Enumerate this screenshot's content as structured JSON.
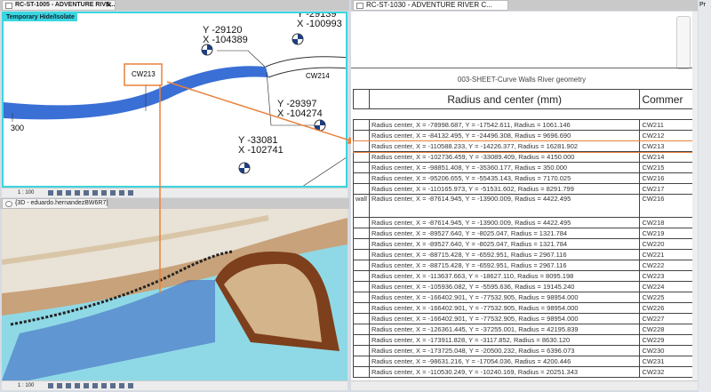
{
  "left_top": {
    "tab_title": "RC-ST-1005 - ADVENTURE RIVE...",
    "badge": "Temporary Hide/Isolate",
    "scale": "1 : 100",
    "tags": [
      {
        "y": "Y -29120",
        "x": "X -104389"
      },
      {
        "y": "Y -29139",
        "x": "X -100993"
      },
      {
        "y": "Y -29397",
        "x": "X -104274"
      },
      {
        "y": "Y -33081",
        "x": "X -102741"
      }
    ],
    "wall_labels": [
      "CW213",
      "CW214"
    ],
    "dim_label": "300"
  },
  "left_bottom": {
    "tab_title": "{3D - eduardo.hernandezBW6R7}",
    "scale": "1 : 100"
  },
  "right": {
    "tab_title": "RC-ST-1030 - ADVENTURE RIVER C...",
    "schedule_title": "003-SHEET-Curve Walls River geometry",
    "headers": [
      "",
      "Radius and center (mm)",
      "Commer"
    ],
    "rows": [
      [
        "",
        "Radius center, X = -78998.687, Y = -17542.611, Radius = 1061.146",
        "CW211"
      ],
      [
        "",
        "Radius center, X = -84132.495, Y = -24496.308, Radius = 9696.690",
        "CW212"
      ],
      [
        "",
        "Radius center, X = -110588.233, Y = -14226.377, Radius = 16281.902",
        "CW213"
      ],
      [
        "",
        "Radius center, X = -102736.459, Y = -33089.409, Radius = 4150.000",
        "CW214"
      ],
      [
        "",
        "Radius center, X = -98851.408, Y = -35360.177, Radius = 350.000",
        "CW215"
      ],
      [
        "",
        "Radius center, X = -95206.655, Y = -55435.143, Radius = 7170.025",
        "CW216"
      ],
      [
        "",
        "Radius center, X = -110165.973, Y = -51531.602, Radius = 8291.799",
        "CW217"
      ],
      [
        "wall",
        "Radius center, X = -87614.945, Y = -13900.009, Radius = 4422.495",
        "CW216"
      ],
      [
        "",
        "Radius center, X = -87614.945, Y = -13900.009, Radius = 4422.495",
        "CW218"
      ],
      [
        "",
        "Radius center, X = -89527.640, Y = -8025.047, Radius = 1321.784",
        "CW219"
      ],
      [
        "",
        "Radius center, X = -89527.640, Y = -8025.047, Radius = 1321.784",
        "CW220"
      ],
      [
        "",
        "Radius center, X = -88715.428, Y = -6592.951, Radius = 2967.116",
        "CW221"
      ],
      [
        "",
        "Radius center, X = -88715.428, Y = -6592.951, Radius = 2967.116",
        "CW222"
      ],
      [
        "",
        "Radius center, X = -113637.663, Y = -18627.110, Radius = 8095.198",
        "CW223"
      ],
      [
        "",
        "Radius center, X = -105936.082, Y = -5595.636, Radius = 19145.240",
        "CW224"
      ],
      [
        "",
        "Radius center, X = -166402.901, Y = -77532.905, Radius = 98954.000",
        "CW225"
      ],
      [
        "",
        "Radius center, X = -166402.901, Y = -77532.905, Radius = 98954.000",
        "CW226"
      ],
      [
        "",
        "Radius center, X = -166402.901, Y = -77532.905, Radius = 98954.000",
        "CW227"
      ],
      [
        "",
        "Radius center, X = -126361.445, Y = -37255.001, Radius = 42195.839",
        "CW228"
      ],
      [
        "",
        "Radius center, X = -173911.828, Y = -3117.852, Radius = 8630.120",
        "CW229"
      ],
      [
        "",
        "Radius center, X = -173725.048, Y = -20500.232, Radius = 6396.073",
        "CW230"
      ],
      [
        "",
        "Radius center, X = -98631.216, Y = -17054.036, Radius = 4200.446",
        "CW231"
      ],
      [
        "",
        "Radius center, X = -110530.249, Y = -10240.169, Radius = 20251.343",
        "CW232"
      ]
    ],
    "highlight_comment": "CW213"
  },
  "properties_stub": "Pr",
  "colors": {
    "highlight": "#e8823c",
    "active_view_border": "#3ad6e0",
    "wall_blue": "#3a6fd6"
  }
}
